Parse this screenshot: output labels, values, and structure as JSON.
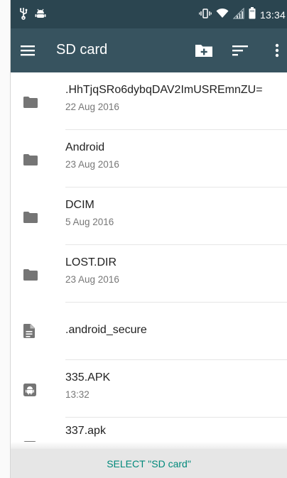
{
  "statusbar": {
    "icons_left": [
      "usb-icon",
      "android-debug-icon"
    ],
    "icons_right": [
      "vibrate-icon",
      "wifi-icon",
      "signal-icon",
      "battery-icon"
    ],
    "time": "13:34"
  },
  "toolbar": {
    "title": "SD card",
    "menu_icon": "hamburger-menu-icon",
    "new_folder_icon": "create-new-folder-icon",
    "sort_icon": "sort-icon",
    "more_icon": "more-vertical-icon"
  },
  "files": [
    {
      "name": ".HhTjqSRo6dybqDAV2ImUSREmnZU=",
      "date": "22 Aug 2016",
      "icon": "folder-icon"
    },
    {
      "name": "Android",
      "date": "23 Aug 2016",
      "icon": "folder-icon"
    },
    {
      "name": "DCIM",
      "date": "5 Aug 2016",
      "icon": "folder-icon"
    },
    {
      "name": "LOST.DIR",
      "date": "23 Aug 2016",
      "icon": "folder-icon"
    },
    {
      "name": ".android_secure",
      "date": "",
      "icon": "file-document-icon"
    },
    {
      "name": "335.APK",
      "date": "13:32",
      "icon": "android-apk-icon"
    },
    {
      "name": "337.apk",
      "date": "",
      "icon": "android-apk-icon"
    }
  ],
  "select_button": "SELECT \"SD card\"",
  "colors": {
    "statusbar": "#2b4550",
    "toolbar": "#37535f",
    "accent": "#00897b",
    "icon_grey": "#757575"
  }
}
